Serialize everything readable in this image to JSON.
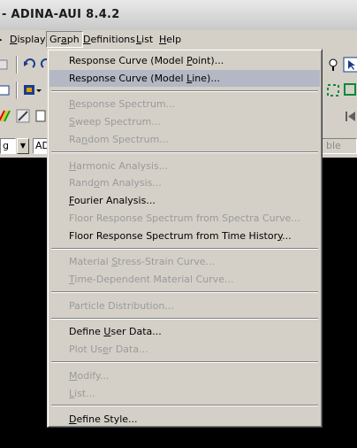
{
  "window": {
    "title": "- ADINA-AUI  8.4.2"
  },
  "menubar": {
    "items": [
      {
        "label": "Display",
        "ul": "D"
      },
      {
        "label": "Graph",
        "ul": "a",
        "open": true
      },
      {
        "label": "Definitions",
        "ul": "D"
      },
      {
        "label": "List",
        "ul": "L"
      },
      {
        "label": "Help",
        "ul": "H"
      }
    ]
  },
  "toolbar": {
    "combo1": {
      "value": "g"
    },
    "combo2": {
      "value": "AD"
    },
    "combo3": {
      "value": "ble"
    }
  },
  "graph_menu": {
    "items": [
      {
        "pre": "Response Curve (Model ",
        "ul": "P",
        "post": "oint)...",
        "enabled": true,
        "highlighted": false
      },
      {
        "pre": "Response Curve (Model ",
        "ul": "L",
        "post": "ine)...",
        "enabled": true,
        "highlighted": true
      },
      {
        "sep": true
      },
      {
        "pre": "",
        "ul": "R",
        "post": "esponse Spectrum...",
        "enabled": false
      },
      {
        "pre": "",
        "ul": "S",
        "post": "weep Spectrum...",
        "enabled": false
      },
      {
        "pre": "Ra",
        "ul": "n",
        "post": "dom Spectrum...",
        "enabled": false
      },
      {
        "sep": true
      },
      {
        "pre": "",
        "ul": "H",
        "post": "armonic Analysis...",
        "enabled": false
      },
      {
        "pre": "Rand",
        "ul": "o",
        "post": "m Analysis...",
        "enabled": false
      },
      {
        "pre": "",
        "ul": "F",
        "post": "ourier Analysis...",
        "enabled": true
      },
      {
        "pre": "Floor Response Spectrum from Spectra Curve...",
        "ul": "",
        "post": "",
        "enabled": false
      },
      {
        "pre": "Floor Response Spectrum from Time Histor",
        "ul": "y",
        "post": "...",
        "enabled": true
      },
      {
        "sep": true
      },
      {
        "pre": "Material ",
        "ul": "S",
        "post": "tress-Strain Curve...",
        "enabled": false
      },
      {
        "pre": "",
        "ul": "T",
        "post": "ime-Dependent Material Curve...",
        "enabled": false
      },
      {
        "sep": true
      },
      {
        "pre": "Particle Distribution...",
        "ul": "",
        "post": "",
        "enabled": false
      },
      {
        "sep": true
      },
      {
        "pre": "Define ",
        "ul": "U",
        "post": "ser Data...",
        "enabled": true
      },
      {
        "pre": "Plot Us",
        "ul": "e",
        "post": "r Data...",
        "enabled": false
      },
      {
        "sep": true
      },
      {
        "pre": "",
        "ul": "M",
        "post": "odify...",
        "enabled": false
      },
      {
        "pre": "",
        "ul": "L",
        "post": "ist...",
        "enabled": false
      },
      {
        "sep": true
      },
      {
        "pre": "",
        "ul": "D",
        "post": "efine Style...",
        "enabled": true
      }
    ]
  }
}
